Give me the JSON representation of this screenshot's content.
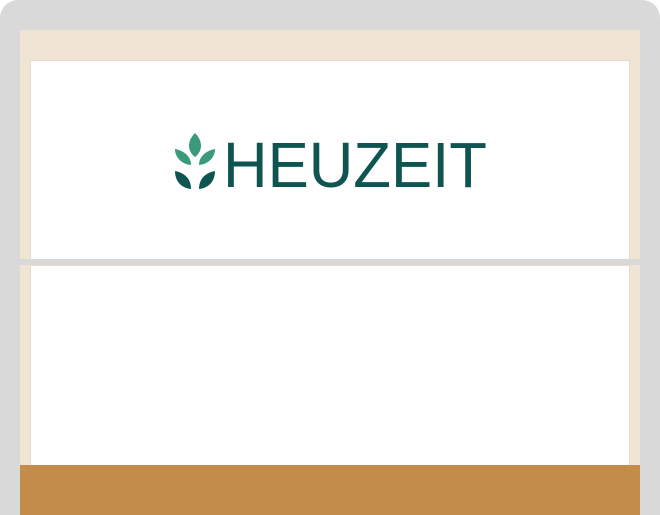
{
  "brand": {
    "name": "HEUZEIT",
    "leaf_icon": "sprouting-leaves-icon"
  },
  "colors": {
    "frame": "#d9d9d9",
    "screen_background": "#f0e4d4",
    "panel_background": "#ffffff",
    "logo_text": "#0e5551",
    "logo_leaf_light": "#3c9a7c",
    "logo_leaf_dark": "#0e5551",
    "bottom_bar": "#c48c4b"
  }
}
